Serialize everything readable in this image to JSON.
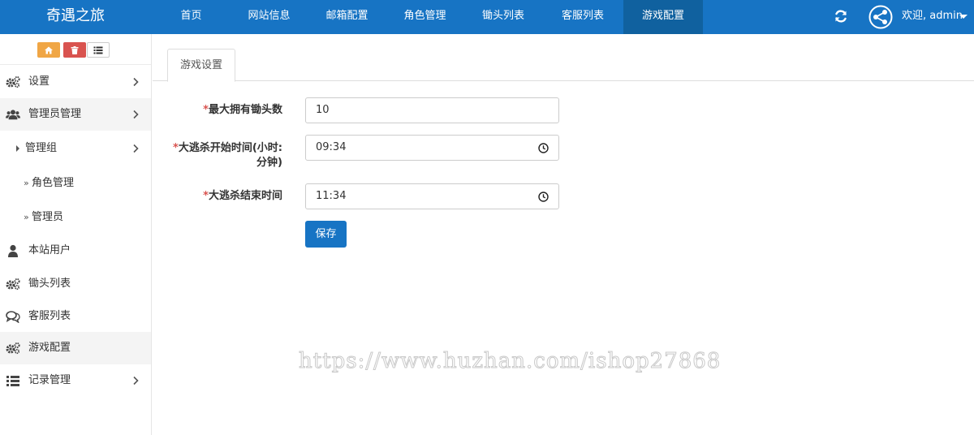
{
  "app": {
    "brand": "奇遇之旅"
  },
  "nav": {
    "items": [
      {
        "label": "首页"
      },
      {
        "label": "网站信息"
      },
      {
        "label": "邮箱配置"
      },
      {
        "label": "角色管理"
      },
      {
        "label": "锄头列表"
      },
      {
        "label": "客服列表"
      },
      {
        "label": "游戏配置"
      }
    ],
    "active_index": 6
  },
  "header": {
    "user_label": "欢迎, admin",
    "icons": [
      "refresh-icon",
      "share-avatar-icon",
      "caret-down-icon"
    ]
  },
  "sidebar": {
    "tool_buttons": [
      {
        "icon": "home-icon",
        "color": "#f0a645"
      },
      {
        "icon": "trash-icon",
        "color": "#d9534f"
      },
      {
        "icon": "list-icon",
        "color": "#ffffff"
      }
    ],
    "items": [
      {
        "label": "设置",
        "icon": "gears-icon",
        "has_chevron": true
      },
      {
        "label": "管理员管理",
        "icon": "users-icon",
        "has_chevron": true,
        "expanded": true
      },
      {
        "label": "管理组",
        "icon": "caret-right-icon",
        "has_chevron": true,
        "level": 1
      },
      {
        "label": "角色管理",
        "icon": "double-angle-right-icon",
        "level": 2
      },
      {
        "label": "管理员",
        "icon": "double-angle-right-icon",
        "level": 2
      },
      {
        "label": "本站用户",
        "icon": "user-icon"
      },
      {
        "label": "锄头列表",
        "icon": "gears-icon"
      },
      {
        "label": "客服列表",
        "icon": "comments-icon"
      },
      {
        "label": "游戏配置",
        "icon": "gears-icon",
        "active": true
      },
      {
        "label": "记录管理",
        "icon": "list-icon",
        "has_chevron": true
      }
    ]
  },
  "main": {
    "tab_label": "游戏设置",
    "form": {
      "fields": [
        {
          "required_mark": "*",
          "label": "最大拥有锄头数",
          "value": "10"
        },
        {
          "required_mark": "*",
          "label_line1": "大逃杀开始时间(小时:",
          "label_line2": "分钟)",
          "value": "09:34"
        },
        {
          "required_mark": "*",
          "label": "大逃杀结束时间",
          "value": "11:34"
        }
      ],
      "save_label": "保存"
    }
  },
  "watermark": "https://www.huzhan.com/ishop27868",
  "colors": {
    "primary": "#1774c4",
    "nav_active": "#10619f",
    "required": "#d9534f",
    "warning": "#f0a645"
  }
}
